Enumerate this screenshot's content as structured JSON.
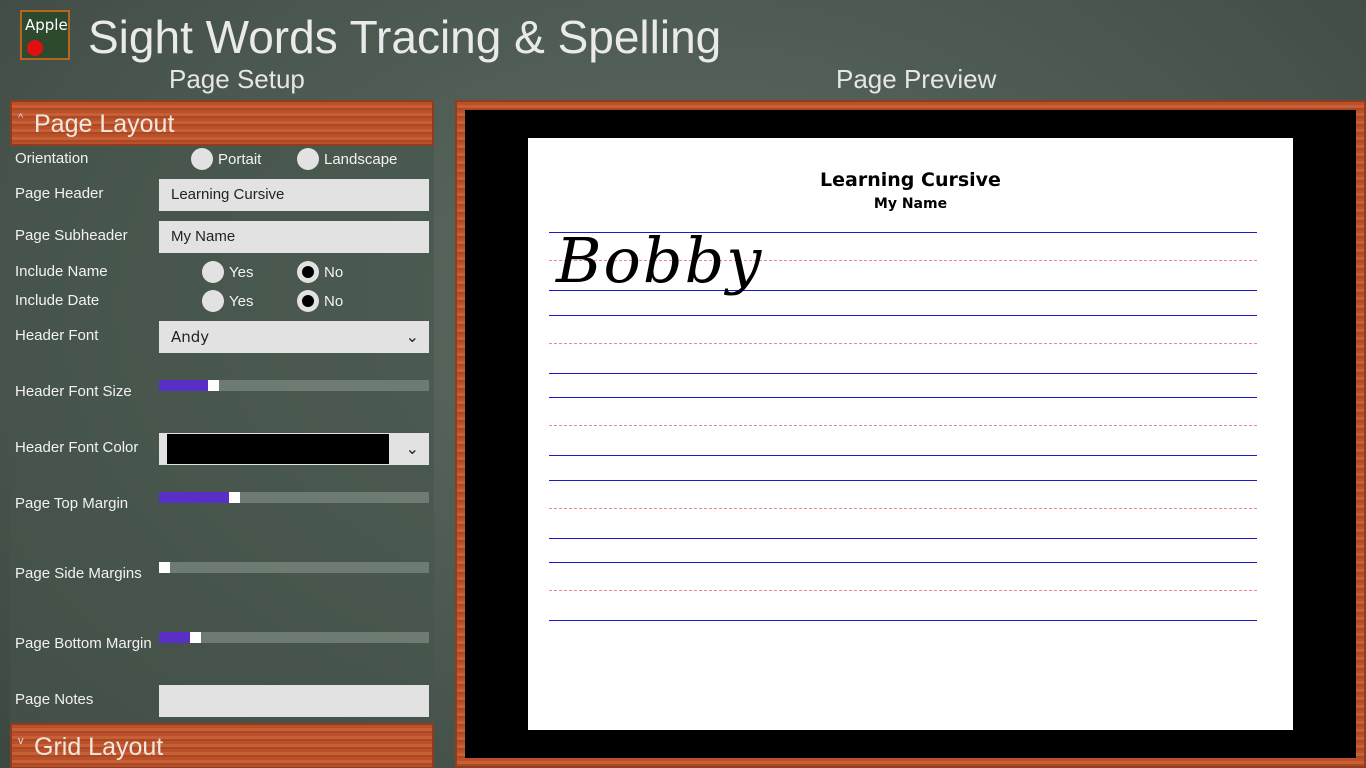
{
  "app": {
    "title": "Sight Words Tracing & Spelling",
    "logo_text": "Apple"
  },
  "setup": {
    "heading": "Page Setup"
  },
  "preview": {
    "heading": "Page Preview",
    "page_header": "Learning Cursive",
    "page_subheader": "My Name",
    "word": "Bobby"
  },
  "page_layout": {
    "section_label": "Page Layout",
    "orientation": {
      "label": "Orientation",
      "options": [
        "Portait",
        "Landscape"
      ],
      "selected": null
    },
    "page_header": {
      "label": "Page Header",
      "value": "Learning Cursive"
    },
    "page_subheader": {
      "label": "Page Subheader",
      "value": "My Name"
    },
    "include_name": {
      "label": "Include Name",
      "yes": "Yes",
      "no": "No",
      "selected": "No"
    },
    "include_date": {
      "label": "Include Date",
      "yes": "Yes",
      "no": "No",
      "selected": "No"
    },
    "header_font": {
      "label": "Header Font",
      "value": "Andy"
    },
    "header_font_size": {
      "label": "Header Font Size",
      "value_pct": 19
    },
    "header_font_color": {
      "label": "Header Font Color",
      "value": "#000000"
    },
    "page_top_margin": {
      "label": "Page Top Margin",
      "value_pct": 27
    },
    "page_side_margins": {
      "label": "Page Side Margins",
      "value_pct": 0
    },
    "page_bottom_margin": {
      "label": "Page Bottom Margin",
      "value_pct": 12
    },
    "page_notes": {
      "label": "Page Notes",
      "value": ""
    }
  },
  "grid_layout": {
    "section_label": "Grid Layout"
  },
  "colors": {
    "accent": "#5a2fc8",
    "guide_blue": "#1a1ac8",
    "guide_pink": "#f08a8a"
  }
}
